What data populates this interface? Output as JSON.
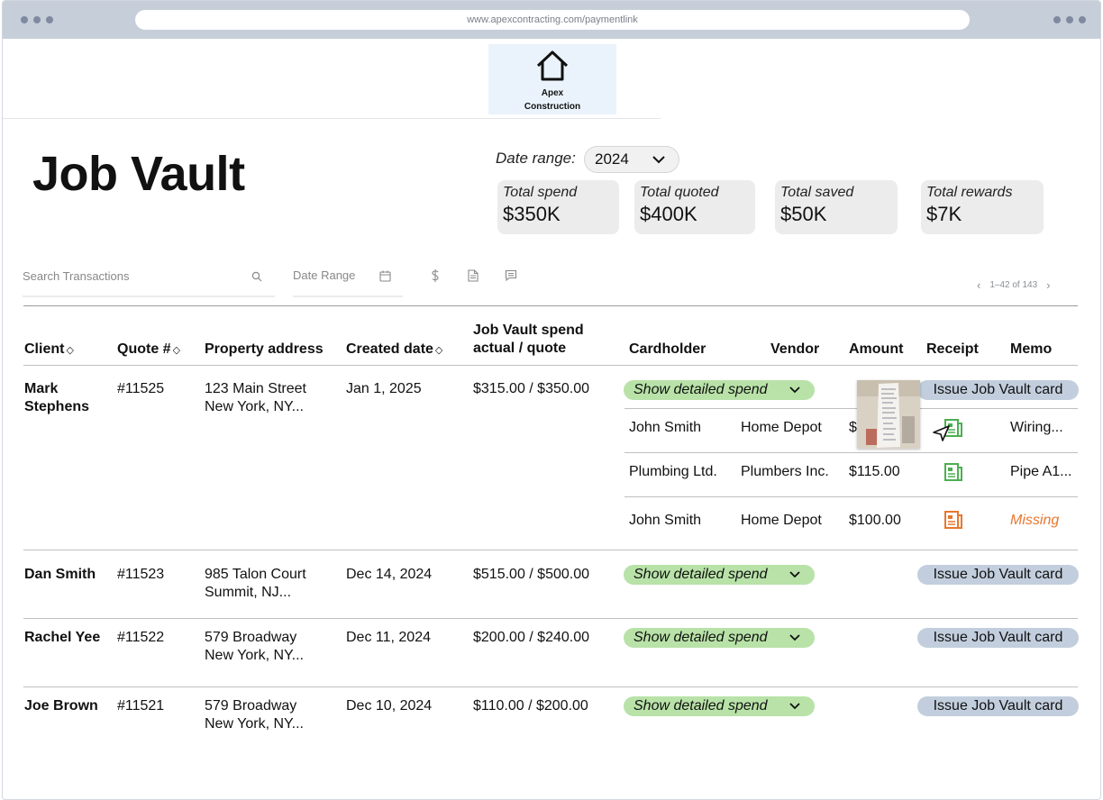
{
  "browser": {
    "url": "www.apexcontracting.com/paymentlink"
  },
  "logo": {
    "line1": "Apex",
    "line2": "Construction"
  },
  "page": {
    "title": "Job Vault"
  },
  "date_range": {
    "label": "Date range:",
    "value": "2024"
  },
  "stats": [
    {
      "label": "Total spend",
      "value": "$350K"
    },
    {
      "label": "Total quoted",
      "value": "$400K"
    },
    {
      "label": "Total saved",
      "value": "$50K"
    },
    {
      "label": "Total rewards",
      "value": "$7K"
    }
  ],
  "toolbar": {
    "search_placeholder": "Search Transactions",
    "date_range_placeholder": "Date Range"
  },
  "pager": {
    "text": "1–42 of 143",
    "prev": "‹",
    "next": "›"
  },
  "columns": {
    "client": "Client",
    "quote": "Quote #",
    "address": "Property address",
    "created": "Created date",
    "spend_line1": "Job Vault spend",
    "spend_line2": "actual / quote",
    "cardholder": "Cardholder",
    "vendor": "Vendor",
    "amount": "Amount",
    "receipt": "Receipt",
    "memo": "Memo"
  },
  "actions": {
    "show_spend": "Show detailed spend",
    "issue_card": "Issue Job Vault card"
  },
  "jobs": [
    {
      "client": "Mark Stephens",
      "quote": "#11525",
      "address_line1": "123 Main Street",
      "address_line2": "New York, NY...",
      "created": "Jan 1, 2025",
      "spend": "$315.00 / $350.00"
    },
    {
      "client": "Dan Smith",
      "quote": "#11523",
      "address_line1": "985 Talon Court",
      "address_line2": "Summit, NJ...",
      "created": "Dec 14, 2024",
      "spend": "$515.00 / $500.00"
    },
    {
      "client": "Rachel Yee",
      "quote": "#11522",
      "address_line1": "579 Broadway",
      "address_line2": "New York, NY...",
      "created": "Dec 11, 2024",
      "spend": "$200.00 / $240.00"
    },
    {
      "client": "Joe Brown",
      "quote": "#11521",
      "address_line1": "579 Broadway",
      "address_line2": "New York, NY...",
      "created": "Dec 10, 2024",
      "spend": "$110.00 / $200.00"
    }
  ],
  "transactions": [
    {
      "cardholder": "John Smith",
      "vendor": "Home Depot",
      "amount": "$",
      "memo": "Wiring...",
      "receipt_status": "attached"
    },
    {
      "cardholder": "Plumbing Ltd.",
      "vendor": "Plumbers Inc.",
      "amount": "$115.00",
      "memo": "Pipe A1...",
      "receipt_status": "attached"
    },
    {
      "cardholder": "John Smith",
      "vendor": "Home Depot",
      "amount": "$100.00",
      "memo": "Missing",
      "receipt_status": "missing"
    }
  ],
  "colors": {
    "pill_green": "#b8e2a8",
    "vault_blue": "#c2cedd",
    "receipt_ok": "#4caf50",
    "receipt_missing": "#e8772e"
  }
}
